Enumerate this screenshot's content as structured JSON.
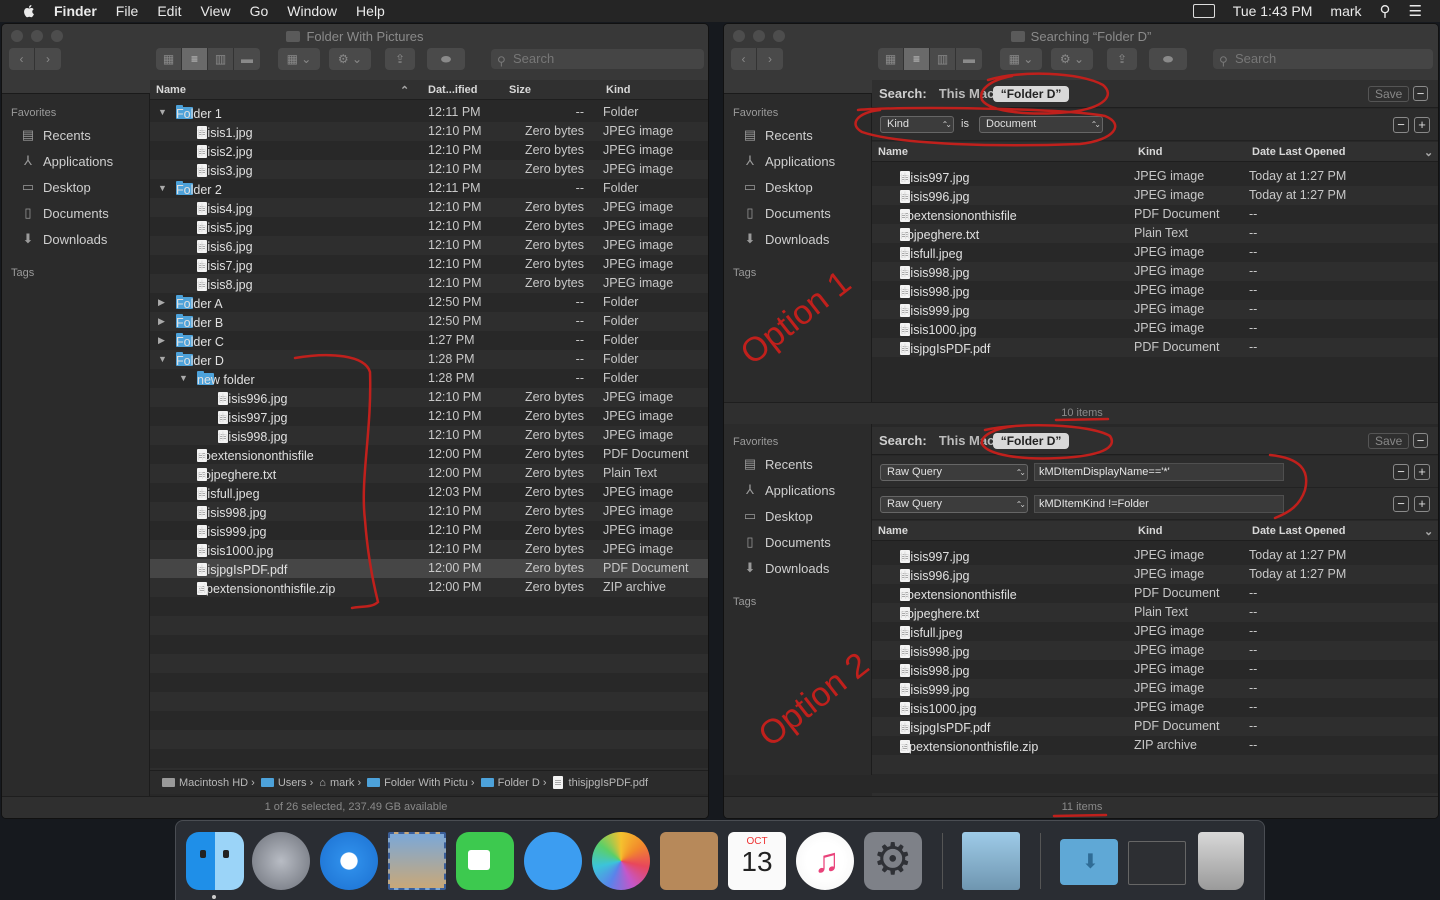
{
  "menubar": {
    "app": "Finder",
    "items": [
      "File",
      "Edit",
      "View",
      "Go",
      "Window",
      "Help"
    ],
    "clock": "Tue 1:43 PM",
    "user": "mark"
  },
  "left_window": {
    "title": "Folder With Pictures",
    "search_placeholder": "Search",
    "sidebar": {
      "favorites_label": "Favorites",
      "items": [
        "Recents",
        "Applications",
        "Desktop",
        "Documents",
        "Downloads"
      ],
      "tags_label": "Tags"
    },
    "columns": {
      "name": "Name",
      "date": "Dat...ified",
      "size": "Size",
      "kind": "Kind"
    },
    "rows": [
      {
        "t": "open",
        "lvl": 0,
        "type": "folder",
        "name": "Folder 1",
        "date": "12:11 PM",
        "size": "--",
        "kind": "Folder"
      },
      {
        "t": "",
        "lvl": 1,
        "type": "doc",
        "name": "thisis1.jpg",
        "date": "12:10 PM",
        "size": "Zero bytes",
        "kind": "JPEG image"
      },
      {
        "t": "",
        "lvl": 1,
        "type": "doc",
        "name": "thisis2.jpg",
        "date": "12:10 PM",
        "size": "Zero bytes",
        "kind": "JPEG image"
      },
      {
        "t": "",
        "lvl": 1,
        "type": "doc",
        "name": "thisis3.jpg",
        "date": "12:10 PM",
        "size": "Zero bytes",
        "kind": "JPEG image"
      },
      {
        "t": "open",
        "lvl": 0,
        "type": "folder",
        "name": "Folder 2",
        "date": "12:11 PM",
        "size": "--",
        "kind": "Folder"
      },
      {
        "t": "",
        "lvl": 1,
        "type": "doc",
        "name": "thisis4.jpg",
        "date": "12:10 PM",
        "size": "Zero bytes",
        "kind": "JPEG image"
      },
      {
        "t": "",
        "lvl": 1,
        "type": "doc",
        "name": "thisis5.jpg",
        "date": "12:10 PM",
        "size": "Zero bytes",
        "kind": "JPEG image"
      },
      {
        "t": "",
        "lvl": 1,
        "type": "doc",
        "name": "thisis6.jpg",
        "date": "12:10 PM",
        "size": "Zero bytes",
        "kind": "JPEG image"
      },
      {
        "t": "",
        "lvl": 1,
        "type": "doc",
        "name": "thisis7.jpg",
        "date": "12:10 PM",
        "size": "Zero bytes",
        "kind": "JPEG image"
      },
      {
        "t": "",
        "lvl": 1,
        "type": "doc",
        "name": "thisis8.jpg",
        "date": "12:10 PM",
        "size": "Zero bytes",
        "kind": "JPEG image"
      },
      {
        "t": "closed",
        "lvl": 0,
        "type": "folder",
        "name": "Folder A",
        "date": "12:50 PM",
        "size": "--",
        "kind": "Folder"
      },
      {
        "t": "closed",
        "lvl": 0,
        "type": "folder",
        "name": "Folder B",
        "date": "12:50 PM",
        "size": "--",
        "kind": "Folder"
      },
      {
        "t": "closed",
        "lvl": 0,
        "type": "folder",
        "name": "Folder C",
        "date": "1:27 PM",
        "size": "--",
        "kind": "Folder"
      },
      {
        "t": "open",
        "lvl": 0,
        "type": "folder",
        "name": "Folder D",
        "date": "1:28 PM",
        "size": "--",
        "kind": "Folder"
      },
      {
        "t": "open",
        "lvl": 1,
        "type": "folder",
        "name": "new folder",
        "date": "1:28 PM",
        "size": "--",
        "kind": "Folder"
      },
      {
        "t": "",
        "lvl": 2,
        "type": "doc",
        "name": "thisis996.jpg",
        "date": "12:10 PM",
        "size": "Zero bytes",
        "kind": "JPEG image"
      },
      {
        "t": "",
        "lvl": 2,
        "type": "doc",
        "name": "thisis997.jpg",
        "date": "12:10 PM",
        "size": "Zero bytes",
        "kind": "JPEG image"
      },
      {
        "t": "",
        "lvl": 2,
        "type": "doc",
        "name": "thisis998.jpg",
        "date": "12:10 PM",
        "size": "Zero bytes",
        "kind": "JPEG image"
      },
      {
        "t": "",
        "lvl": 1,
        "type": "doc",
        "name": "noextensiononthisfile",
        "date": "12:00 PM",
        "size": "Zero bytes",
        "kind": "PDF Document"
      },
      {
        "t": "",
        "lvl": 1,
        "type": "doc",
        "name": "nojpeghere.txt",
        "date": "12:00 PM",
        "size": "Zero bytes",
        "kind": "Plain Text"
      },
      {
        "t": "",
        "lvl": 1,
        "type": "doc",
        "name": "thisfull.jpeg",
        "date": "12:03 PM",
        "size": "Zero bytes",
        "kind": "JPEG image"
      },
      {
        "t": "",
        "lvl": 1,
        "type": "doc",
        "name": "thisis998.jpg",
        "date": "12:10 PM",
        "size": "Zero bytes",
        "kind": "JPEG image"
      },
      {
        "t": "",
        "lvl": 1,
        "type": "doc",
        "name": "thisis999.jpg",
        "date": "12:10 PM",
        "size": "Zero bytes",
        "kind": "JPEG image"
      },
      {
        "t": "",
        "lvl": 1,
        "type": "doc",
        "name": "thisis1000.jpg",
        "date": "12:10 PM",
        "size": "Zero bytes",
        "kind": "JPEG image"
      },
      {
        "t": "",
        "lvl": 1,
        "type": "doc",
        "name": "thisjpgIsPDF.pdf",
        "date": "12:00 PM",
        "size": "Zero bytes",
        "kind": "PDF Document",
        "sel": true
      },
      {
        "t": "",
        "lvl": 1,
        "type": "doc",
        "name": "zipextensiononthisfile.zip",
        "date": "12:00 PM",
        "size": "Zero bytes",
        "kind": "ZIP archive"
      }
    ],
    "path": [
      "Macintosh HD",
      "Users",
      "mark",
      "Folder With Pictu",
      "Folder D",
      "thisjpgIsPDF.pdf"
    ],
    "status": "1 of 26 selected, 237.49 GB available"
  },
  "right_window": {
    "title": "Searching “Folder D”",
    "search_placeholder": "Search",
    "search_label": "Search:",
    "this_mac": "This Mac",
    "scope_pill": "“Folder D”",
    "save_label": "Save",
    "sidebar": {
      "favorites_label": "Favorites",
      "items": [
        "Recents",
        "Applications",
        "Desktop",
        "Documents",
        "Downloads"
      ],
      "tags_label": "Tags"
    },
    "columns": {
      "name": "Name",
      "kind": "Kind",
      "date": "Date Last Opened"
    },
    "pane1": {
      "criteria": {
        "attr": "Kind",
        "op": "is",
        "value": "Document"
      },
      "rows": [
        {
          "name": "thisis997.jpg",
          "kind": "JPEG image",
          "date": "Today at 1:27 PM"
        },
        {
          "name": "thisis996.jpg",
          "kind": "JPEG image",
          "date": "Today at 1:27 PM"
        },
        {
          "name": "noextensiononthisfile",
          "kind": "PDF Document",
          "date": "--"
        },
        {
          "name": "nojpeghere.txt",
          "kind": "Plain Text",
          "date": "--"
        },
        {
          "name": "thisfull.jpeg",
          "kind": "JPEG image",
          "date": "--"
        },
        {
          "name": "thisis998.jpg",
          "kind": "JPEG image",
          "date": "--"
        },
        {
          "name": "thisis998.jpg",
          "kind": "JPEG image",
          "date": "--"
        },
        {
          "name": "thisis999.jpg",
          "kind": "JPEG image",
          "date": "--"
        },
        {
          "name": "thisis1000.jpg",
          "kind": "JPEG image",
          "date": "--"
        },
        {
          "name": "thisjpgIsPDF.pdf",
          "kind": "PDF Document",
          "date": "--"
        }
      ],
      "status": "10 items",
      "annotation": "Option 1"
    },
    "pane2": {
      "criteria": [
        {
          "attr": "Raw Query",
          "value": "kMDItemDisplayName=='*'"
        },
        {
          "attr": "Raw Query",
          "value": "kMDItemKind !=Folder"
        }
      ],
      "rows": [
        {
          "name": "thisis997.jpg",
          "kind": "JPEG image",
          "date": "Today at 1:27 PM"
        },
        {
          "name": "thisis996.jpg",
          "kind": "JPEG image",
          "date": "Today at 1:27 PM"
        },
        {
          "name": "noextensiononthisfile",
          "kind": "PDF Document",
          "date": "--"
        },
        {
          "name": "nojpeghere.txt",
          "kind": "Plain Text",
          "date": "--"
        },
        {
          "name": "thisfull.jpeg",
          "kind": "JPEG image",
          "date": "--"
        },
        {
          "name": "thisis998.jpg",
          "kind": "JPEG image",
          "date": "--"
        },
        {
          "name": "thisis998.jpg",
          "kind": "JPEG image",
          "date": "--"
        },
        {
          "name": "thisis999.jpg",
          "kind": "JPEG image",
          "date": "--"
        },
        {
          "name": "thisis1000.jpg",
          "kind": "JPEG image",
          "date": "--"
        },
        {
          "name": "thisjpgIsPDF.pdf",
          "kind": "PDF Document",
          "date": "--"
        },
        {
          "name": "zipextensiononthisfile.zip",
          "kind": "ZIP archive",
          "date": "--"
        }
      ],
      "status": "11 items",
      "annotation": "Option 2"
    }
  },
  "dock": {
    "apps": [
      "finder",
      "launchpad",
      "safari",
      "mail",
      "facetime",
      "messages",
      "photos",
      "contacts",
      "calendar",
      "itunes",
      "system-preferences",
      "preview",
      "downloads",
      "screenshot",
      "trash"
    ],
    "calendar_month": "OCT",
    "calendar_day": "13"
  },
  "colors": {
    "annotation": "#c0201c",
    "folder": "#4da2da"
  }
}
